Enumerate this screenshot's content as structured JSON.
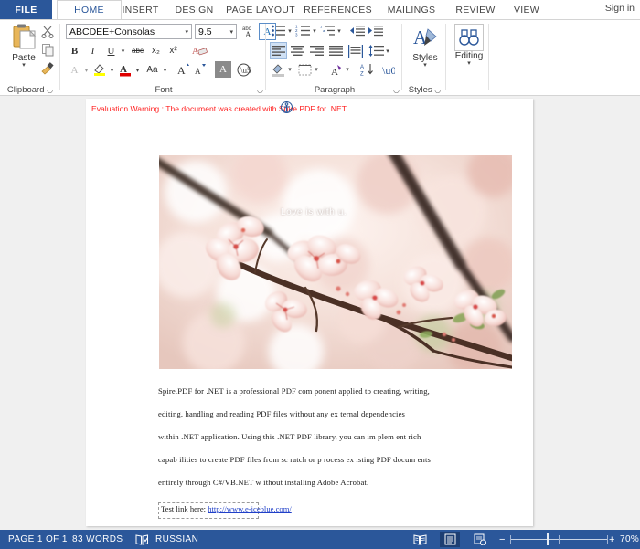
{
  "app": {
    "tabs": [
      {
        "label": "FILE",
        "name": "tab-file"
      },
      {
        "label": "HOME",
        "name": "tab-home"
      },
      {
        "label": "INSERT",
        "name": "tab-insert"
      },
      {
        "label": "DESIGN",
        "name": "tab-design"
      },
      {
        "label": "PAGE LAYOUT",
        "name": "tab-page-layout"
      },
      {
        "label": "REFERENCES",
        "name": "tab-references"
      },
      {
        "label": "MAILINGS",
        "name": "tab-mailings"
      },
      {
        "label": "REVIEW",
        "name": "tab-review"
      },
      {
        "label": "VIEW",
        "name": "tab-view"
      }
    ],
    "sign_in": "Sign in",
    "accent_color": "#2b579a"
  },
  "ribbon": {
    "clipboard": {
      "group_label": "Clipboard",
      "paste_label": "Paste",
      "dialog_launcher": "↘",
      "buttons": [
        {
          "name": "cut-icon",
          "title": "Cut"
        },
        {
          "name": "copy-icon",
          "title": "Copy"
        },
        {
          "name": "format-painter-icon",
          "title": "Format Painter"
        }
      ]
    },
    "font": {
      "group_label": "Font",
      "font_name": "ABCDEE+Consolas",
      "font_size": "9.5",
      "dropdown_caret": "▾",
      "dialog_launcher": "↘",
      "buttons": [
        {
          "name": "bold-button",
          "label": "B"
        },
        {
          "name": "italic-button",
          "label": "I"
        },
        {
          "name": "underline-button",
          "label": "U"
        },
        {
          "name": "strikethrough-button",
          "label": "abc"
        },
        {
          "name": "subscript-button",
          "label": "x₂"
        },
        {
          "name": "superscript-button",
          "label": "x²"
        },
        {
          "name": "clear-formatting-button",
          "label": "A"
        },
        {
          "name": "text-effects-button",
          "label": "A"
        },
        {
          "name": "text-highlight-color-button",
          "label": "ab"
        },
        {
          "name": "font-color-button",
          "label": "A"
        },
        {
          "name": "change-case-button",
          "label": "Aa"
        },
        {
          "name": "grow-font-button",
          "label": "A"
        },
        {
          "name": "shrink-font-button",
          "label": "A"
        },
        {
          "name": "character-shading-button",
          "label": "A"
        },
        {
          "name": "character-border-button",
          "label": "囲"
        },
        {
          "name": "phonetic-guide-button",
          "label": "abc"
        },
        {
          "name": "text-effects-gallery-button",
          "label": "A"
        }
      ]
    },
    "paragraph": {
      "group_label": "Paragraph",
      "dialog_launcher": "↘",
      "buttons": [
        {
          "name": "bullets-button",
          "title": "Bullets"
        },
        {
          "name": "numbering-button",
          "title": "Numbering"
        },
        {
          "name": "multilevel-list-button",
          "title": "Multilevel List"
        },
        {
          "name": "decrease-indent-button",
          "title": "Decrease Indent"
        },
        {
          "name": "increase-indent-button",
          "title": "Increase Indent"
        },
        {
          "name": "align-left-button",
          "title": "Align Left"
        },
        {
          "name": "align-center-button",
          "title": "Center"
        },
        {
          "name": "align-right-button",
          "title": "Align Right"
        },
        {
          "name": "justify-button",
          "title": "Justify"
        },
        {
          "name": "distributed-button",
          "title": "Distributed"
        },
        {
          "name": "line-spacing-button",
          "title": "Line and Paragraph Spacing"
        },
        {
          "name": "shading-button",
          "title": "Shading"
        },
        {
          "name": "borders-button",
          "title": "Borders"
        },
        {
          "name": "asian-layout-button",
          "title": "Asian Layout"
        },
        {
          "name": "sort-button",
          "title": "Sort"
        },
        {
          "name": "show-formatting-marks-button",
          "title": "Show/Hide"
        }
      ]
    },
    "styles": {
      "group_label": "Styles",
      "button_label": "Styles",
      "caret": "▾",
      "dialog_launcher": "↘"
    },
    "editing": {
      "group_label": "",
      "button_label": "Editing",
      "caret": "▾"
    }
  },
  "document": {
    "evaluation_warning": "Evaluation Warning : The document was created with Spire.PDF for .NET.",
    "anchor_icon": "object-anchor-icon",
    "image": {
      "name": "cherry-blossom-image",
      "overlay_text": "Love is with u.",
      "alt": "Cherry blossom branch in bloom"
    },
    "paragraph_lines": [
      "Spire.PDF for .NET is a professional PDF com ponent applied to creating, writing,",
      "editing,  handling  and  reading  PDF  files  without  any  ex ternal dependencies",
      "within  .NET  application.  Using  this  .NET  PDF  library,  you  can   im plem ent rich",
      "capab ilities to create PDF files from   sc ratch or p rocess ex isting PDF docum ents",
      "entirely through C#/VB.NET w ithout installing Adobe Acrobat."
    ],
    "link_label": "Test link here:",
    "link_text": "http://www.e-iceblue.com/"
  },
  "status_bar": {
    "page_info": "PAGE 1 OF 1",
    "word_count": "83 WORDS",
    "proofing_icon": "proofing-errors-icon",
    "language": "RUSSIAN",
    "views": [
      {
        "name": "read-mode-button",
        "title": "Read Mode",
        "selected": false
      },
      {
        "name": "print-layout-button",
        "title": "Print Layout",
        "selected": true
      },
      {
        "name": "web-layout-button",
        "title": "Web Layout",
        "selected": false
      }
    ],
    "zoom_out": "−",
    "zoom_in": "+",
    "zoom_level": "70%"
  }
}
